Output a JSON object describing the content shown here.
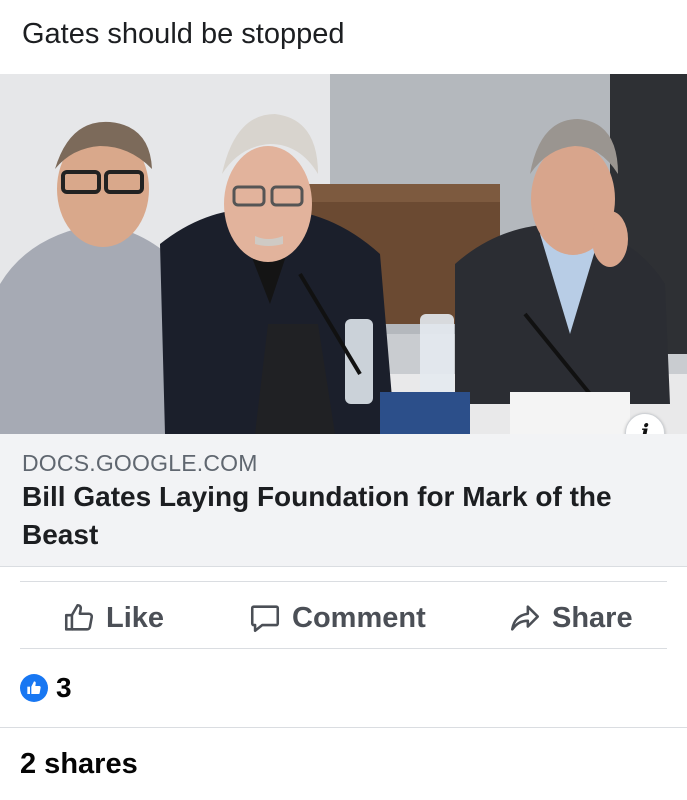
{
  "post": {
    "text": "Gates should be stopped"
  },
  "link": {
    "image": "photo of three men seated at a conference table with microphones",
    "info_icon": "i",
    "domain": "DOCS.GOOGLE.COM",
    "title": "Bill Gates Laying Foundation for Mark of the Beast"
  },
  "actions": {
    "like_label": "Like",
    "comment_label": "Comment",
    "share_label": "Share"
  },
  "reactions": {
    "count": "3",
    "icon": "thumbs-up-icon",
    "color": "#1877f2"
  },
  "shares": {
    "text": "2 shares"
  }
}
